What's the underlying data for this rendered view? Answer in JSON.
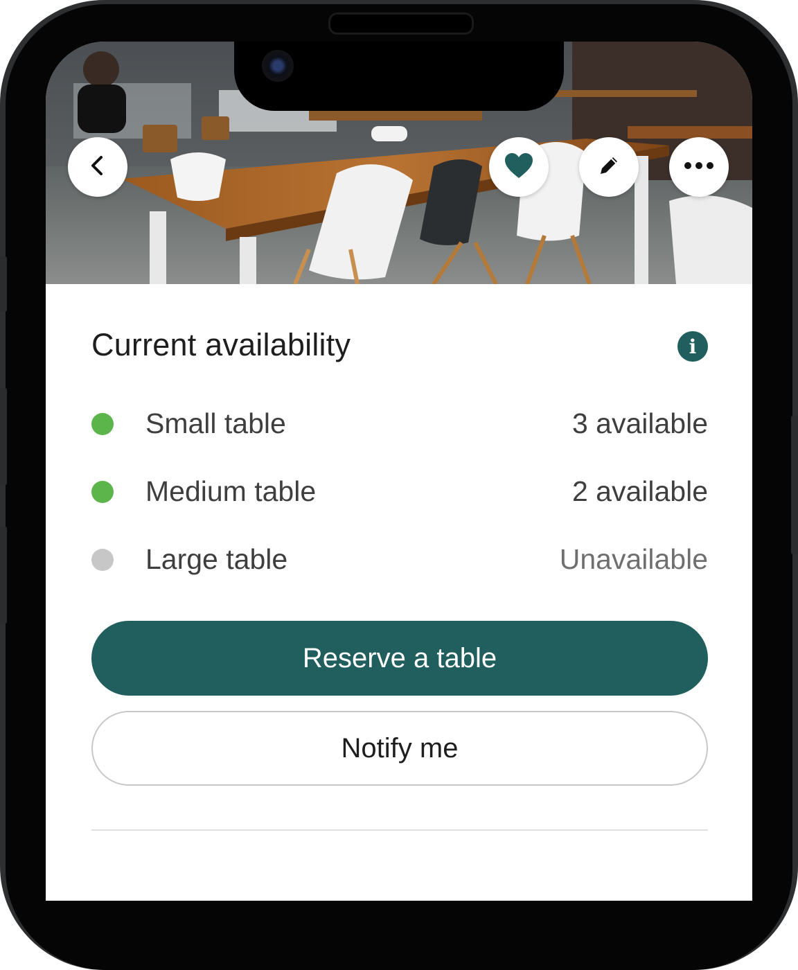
{
  "colors": {
    "accent": "#215f5e",
    "available": "#5cb54b",
    "unavailable": "#c7c7c7"
  },
  "header": {
    "icons": {
      "back": "chevron-left-icon",
      "favorite": "heart-icon",
      "edit": "pencil-icon",
      "more": "more-horizontal-icon"
    }
  },
  "availability": {
    "title": "Current availability",
    "info_icon": "info-icon",
    "info_glyph": "i",
    "rows": [
      {
        "label": "Small table",
        "status": "3 available",
        "available": true
      },
      {
        "label": "Medium table",
        "status": "2 available",
        "available": true
      },
      {
        "label": "Large table",
        "status": "Unavailable",
        "available": false
      }
    ]
  },
  "actions": {
    "reserve_label": "Reserve a table",
    "notify_label": "Notify me"
  }
}
